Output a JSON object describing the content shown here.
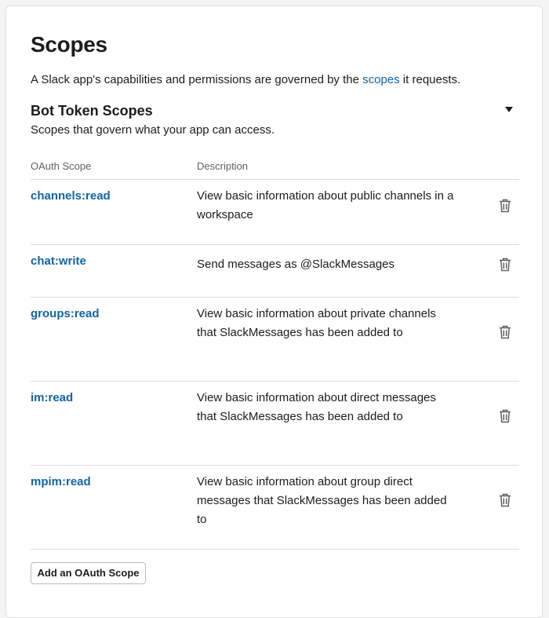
{
  "header": {
    "title": "Scopes",
    "intro_before": "A Slack app's capabilities and permissions are governed by the ",
    "intro_link": "scopes",
    "intro_after": " it requests."
  },
  "section": {
    "title": "Bot Token Scopes",
    "subtitle": "Scopes that govern what your app can access.",
    "collapse_icon": "caret-down-icon"
  },
  "table": {
    "col_scope": "OAuth Scope",
    "col_desc": "Description",
    "rows": [
      {
        "scope": "channels:read",
        "description": "View basic information about public channels in a workspace"
      },
      {
        "scope": "chat:write",
        "description": "Send messages as @SlackMessages"
      },
      {
        "scope": "groups:read",
        "description": "View basic information about private channels that SlackMessages has been added to"
      },
      {
        "scope": "im:read",
        "description": "View basic information about direct messages that SlackMessages has been added to"
      },
      {
        "scope": "mpim:read",
        "description": "View basic information about group direct messages that SlackMessages has been added to"
      }
    ],
    "row_action_icon": "trash-icon"
  },
  "actions": {
    "add_scope_label": "Add an OAuth Scope"
  },
  "colors": {
    "link": "#1264a3",
    "text": "#1d1c1d",
    "muted": "#616061",
    "border": "#dddddd"
  }
}
